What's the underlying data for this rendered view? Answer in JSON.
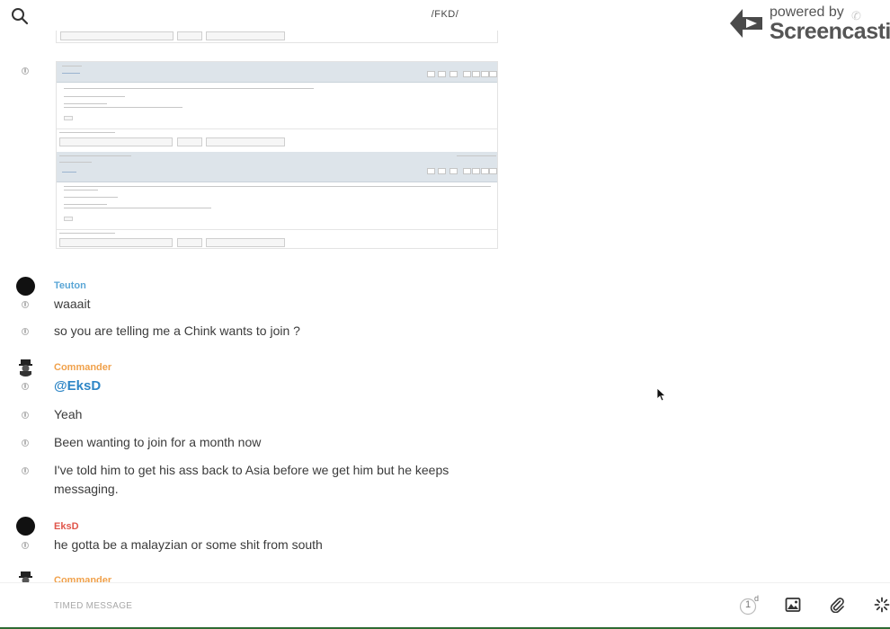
{
  "header": {
    "channel": "/FKD/",
    "search_icon": "search-icon"
  },
  "watermark": {
    "small": "powered by",
    "big": "Screencastify"
  },
  "messages": [
    {
      "type": "message",
      "text": "waaait"
    },
    {
      "type": "message",
      "text": "so you are telling me a Chink wants to join ?"
    },
    {
      "type": "mention",
      "text": "@EksD"
    },
    {
      "type": "message",
      "text": "Yeah"
    },
    {
      "type": "message",
      "text": "Been wanting to join for a month now"
    },
    {
      "type": "message",
      "text": "I've told him to get his ass back to Asia before we get him but he keeps messaging."
    },
    {
      "type": "message",
      "text": "he gotta be a malayzian or some shit from south"
    }
  ],
  "senders": {
    "teuton": {
      "name": "Teuton",
      "color": "#5aa6d6"
    },
    "commander": {
      "name": "Commander",
      "color": "#f0a14b"
    },
    "eksd": {
      "name": "EksD",
      "color": "#e0564b"
    },
    "commander2": {
      "name": "Commander",
      "color": "#f0a14b"
    }
  },
  "composer": {
    "placeholder": "TIMED MESSAGE",
    "timer_value": "1",
    "timer_unit": "d",
    "icons": [
      "timer-icon",
      "image-icon",
      "paperclip-icon",
      "loading-icon"
    ]
  }
}
